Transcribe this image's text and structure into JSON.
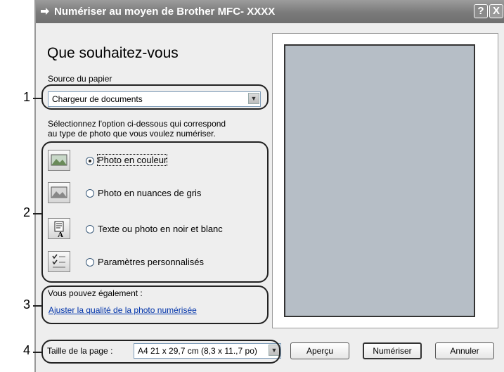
{
  "window": {
    "title": "Numériser au moyen de Brother MFC- XXXX",
    "help_button": "?",
    "close_button": "X"
  },
  "heading": "Que souhaitez-vous",
  "paper_source": {
    "label": "Source du papier",
    "value": "Chargeur de documents"
  },
  "instructions": {
    "line1": "Sélectionnez l'option ci-dessous qui correspond",
    "line2": "au type de photo que vous voulez numériser."
  },
  "options": [
    {
      "label": "Photo en couleur",
      "icon": "color-photo-icon",
      "selected": true
    },
    {
      "label": "Photo en nuances de gris",
      "icon": "grayscale-photo-icon",
      "selected": false
    },
    {
      "label": "Texte ou photo en noir et blanc",
      "icon": "text-bw-icon",
      "selected": false
    },
    {
      "label": "Paramètres personnalisés",
      "icon": "custom-settings-icon",
      "selected": false
    }
  ],
  "also": {
    "label": "Vous pouvez également :",
    "link": "Ajuster la qualité de la photo numérisée"
  },
  "page_size": {
    "label": "Taille de la page :",
    "value": "A4 21 x 29,7 cm (8,3 x 11.,7 po)"
  },
  "buttons": {
    "preview": "Aperçu",
    "scan": "Numériser",
    "cancel": "Annuler"
  },
  "callouts": [
    "1",
    "2",
    "3",
    "4"
  ]
}
